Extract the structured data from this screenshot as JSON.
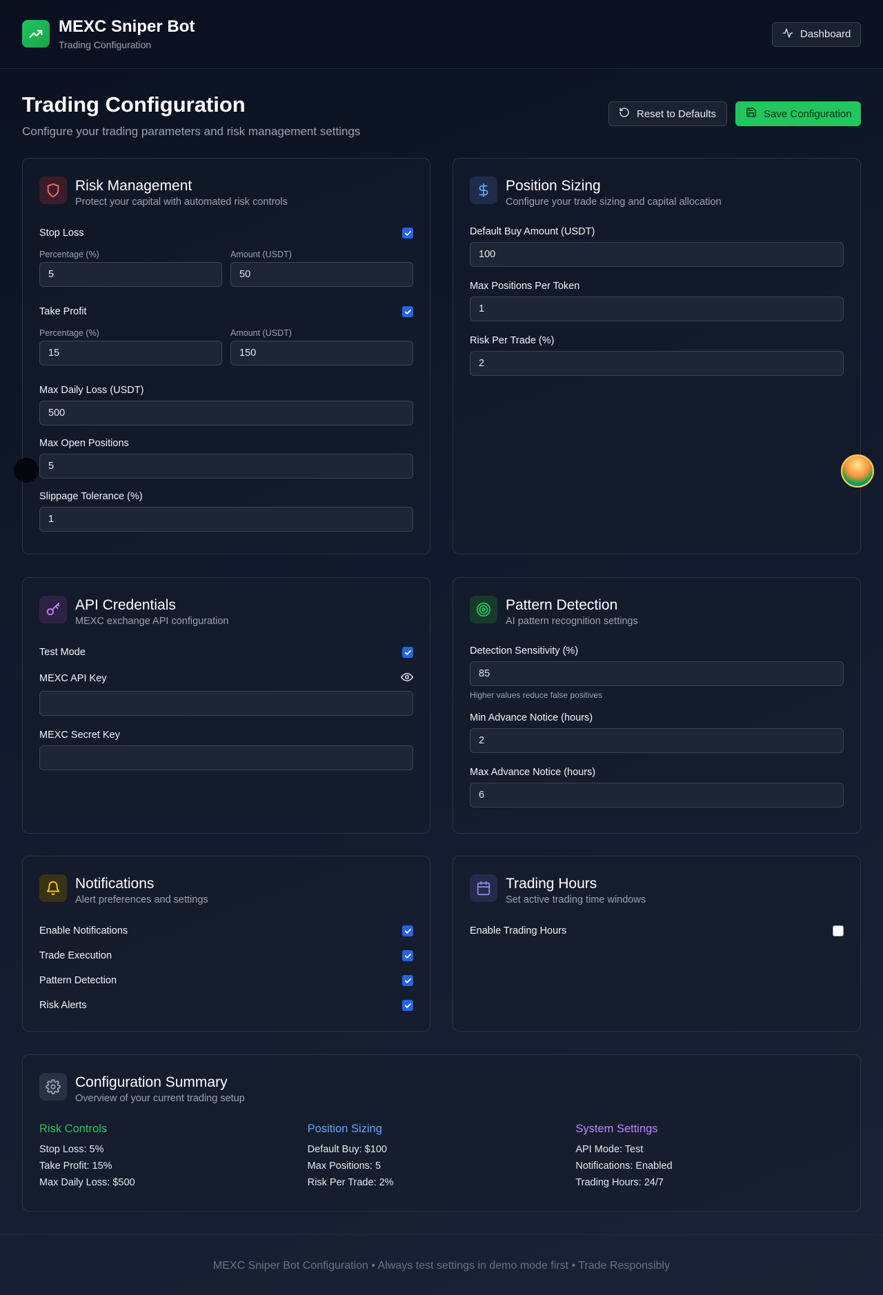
{
  "header": {
    "app_title": "MEXC Sniper Bot",
    "app_subtitle": "Trading Configuration",
    "dashboard_label": "Dashboard"
  },
  "page": {
    "title": "Trading Configuration",
    "subtitle": "Configure your trading parameters and risk management settings",
    "reset_label": "Reset to Defaults",
    "save_label": "Save Configuration"
  },
  "risk": {
    "title": "Risk Management",
    "desc": "Protect your capital with automated risk controls",
    "stop_loss_label": "Stop Loss",
    "stop_loss_enabled": true,
    "stop_pct_label": "Percentage (%)",
    "stop_pct_value": "5",
    "stop_amt_label": "Amount (USDT)",
    "stop_amt_value": "50",
    "take_profit_label": "Take Profit",
    "take_profit_enabled": true,
    "tp_pct_label": "Percentage (%)",
    "tp_pct_value": "15",
    "tp_amt_label": "Amount (USDT)",
    "tp_amt_value": "150",
    "max_daily_loss_label": "Max Daily Loss (USDT)",
    "max_daily_loss_value": "500",
    "max_open_positions_label": "Max Open Positions",
    "max_open_positions_value": "5",
    "slippage_label": "Slippage Tolerance (%)",
    "slippage_value": "1"
  },
  "sizing": {
    "title": "Position Sizing",
    "desc": "Configure your trade sizing and capital allocation",
    "default_buy_label": "Default Buy Amount (USDT)",
    "default_buy_value": "100",
    "max_positions_label": "Max Positions Per Token",
    "max_positions_value": "1",
    "risk_per_trade_label": "Risk Per Trade (%)",
    "risk_per_trade_value": "2"
  },
  "api": {
    "title": "API Credentials",
    "desc": "MEXC exchange API configuration",
    "test_mode_label": "Test Mode",
    "test_mode_enabled": true,
    "api_key_label": "MEXC API Key",
    "api_key_value": "",
    "secret_key_label": "MEXC Secret Key",
    "secret_key_value": ""
  },
  "pattern": {
    "title": "Pattern Detection",
    "desc": "AI pattern recognition settings",
    "sensitivity_label": "Detection Sensitivity (%)",
    "sensitivity_value": "85",
    "sensitivity_hint": "Higher values reduce false positives",
    "min_notice_label": "Min Advance Notice (hours)",
    "min_notice_value": "2",
    "max_notice_label": "Max Advance Notice (hours)",
    "max_notice_value": "6"
  },
  "notifications": {
    "title": "Notifications",
    "desc": "Alert preferences and settings",
    "items": [
      {
        "label": "Enable Notifications",
        "checked": true
      },
      {
        "label": "Trade Execution",
        "checked": true
      },
      {
        "label": "Pattern Detection",
        "checked": true
      },
      {
        "label": "Risk Alerts",
        "checked": true
      }
    ]
  },
  "hours": {
    "title": "Trading Hours",
    "desc": "Set active trading time windows",
    "enable_label": "Enable Trading Hours",
    "enabled": false
  },
  "summary": {
    "title": "Configuration Summary",
    "desc": "Overview of your current trading setup",
    "risk_head": "Risk Controls",
    "risk_items": [
      "Stop Loss: 5%",
      "Take Profit: 15%",
      "Max Daily Loss: $500"
    ],
    "sizing_head": "Position Sizing",
    "sizing_items": [
      "Default Buy: $100",
      "Max Positions: 5",
      "Risk Per Trade: 2%"
    ],
    "system_head": "System Settings",
    "system_items": [
      "API Mode: Test",
      "Notifications: Enabled",
      "Trading Hours: 24/7"
    ]
  },
  "footer": {
    "text": "MEXC Sniper Bot Configuration • Always test settings in demo mode first • Trade Responsibly"
  },
  "colors": {
    "accent_green": "#22c55e",
    "accent_blue": "#60a5fa",
    "accent_purple": "#c084fc",
    "checkbox_blue": "#2563eb"
  }
}
